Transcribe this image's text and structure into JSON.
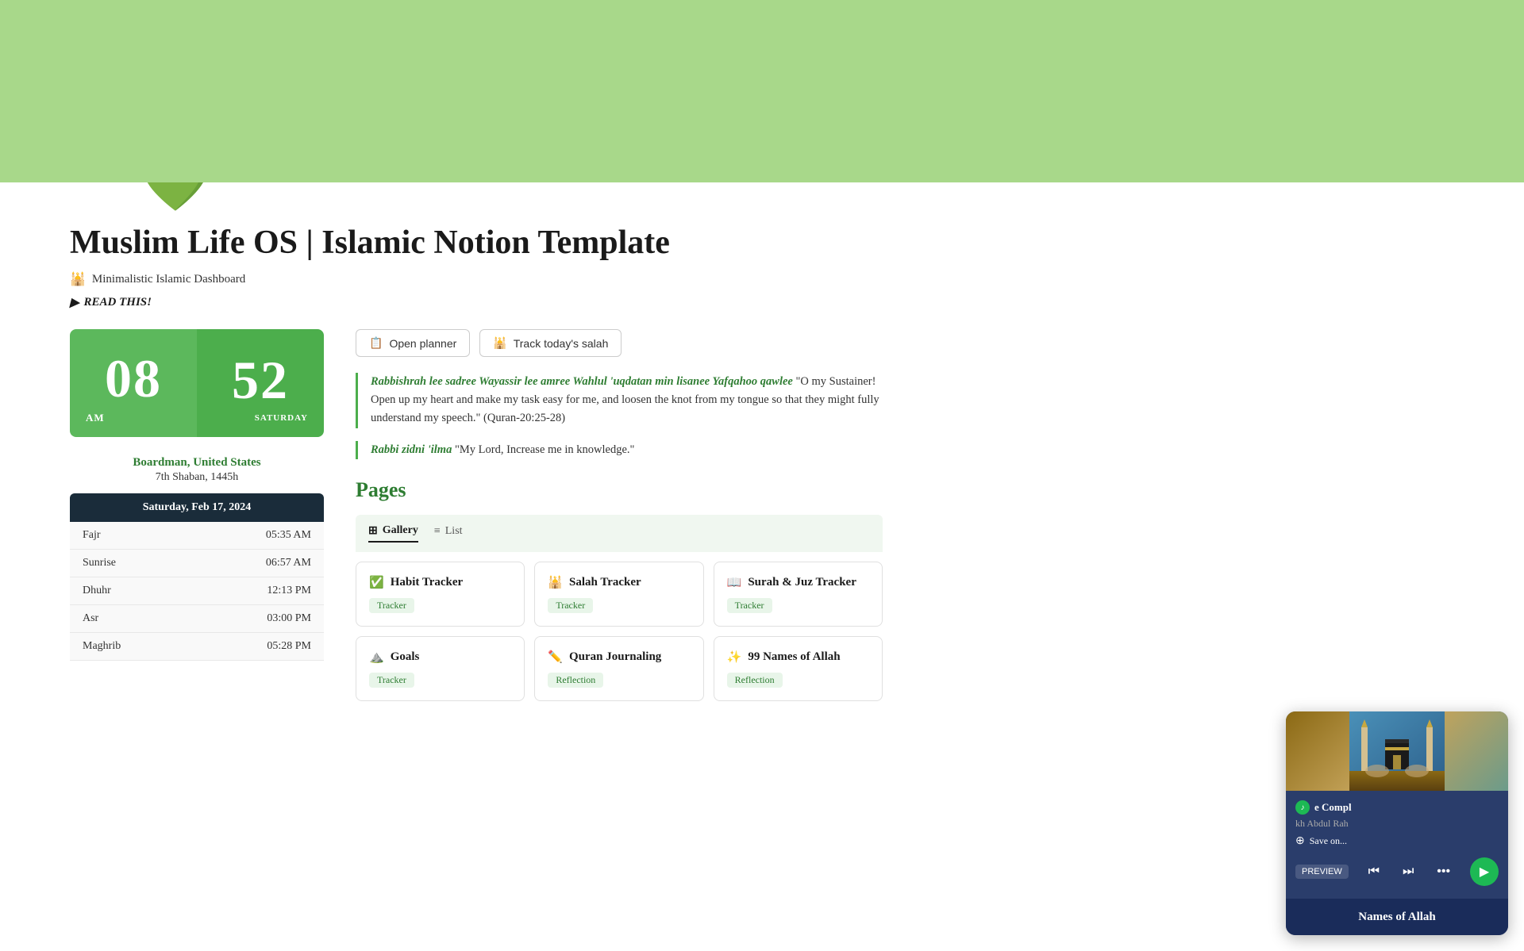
{
  "header": {
    "banner_color": "#a8d88a",
    "icon": "💚",
    "title": "Muslim Life OS | Islamic Notion Template",
    "subtitle": "Minimalistic Islamic Dashboard",
    "read_this_label": "READ THIS!"
  },
  "clock": {
    "hours": "08",
    "minutes": "52",
    "am_pm": "AM",
    "day": "SATURDAY"
  },
  "location": {
    "city": "Boardman, United States",
    "hijri_date": "7th Shaban, 1445h"
  },
  "prayer_date": "Saturday, Feb 17, 2024",
  "prayer_times": [
    {
      "name": "Fajr",
      "time": "05:35 AM"
    },
    {
      "name": "Sunrise",
      "time": "06:57 AM"
    },
    {
      "name": "Dhuhr",
      "time": "12:13 PM"
    },
    {
      "name": "Asr",
      "time": "03:00 PM"
    },
    {
      "name": "Maghrib",
      "time": "05:28 PM"
    }
  ],
  "buttons": {
    "open_planner": "Open planner",
    "track_salah": "Track today's salah"
  },
  "quote1": {
    "arabic": "Rabbishrah lee sadree Wayassir lee amree Wahlul 'uqdatan min lisanee Yafqahoo qawlee",
    "translation": " \"O my Sustainer! Open up my heart and make my task easy for me, and loosen the knot from my tongue so that they might fully understand my speech.\" (Quran-20:25-28)"
  },
  "quote2": {
    "arabic": "Rabbi zidni 'ilma",
    "translation": " \"My Lord, Increase me in knowledge.\""
  },
  "pages": {
    "title": "Pages",
    "tabs": [
      {
        "label": "Gallery",
        "active": true
      },
      {
        "label": "List",
        "active": false
      }
    ],
    "cards": [
      {
        "icon": "✅",
        "title": "Habit Tracker",
        "tag": "Tracker",
        "tag_type": "tracker"
      },
      {
        "icon": "🕌",
        "title": "Salah Tracker",
        "tag": "Tracker",
        "tag_type": "tracker"
      },
      {
        "icon": "📖",
        "title": "Surah & Juz Tracker",
        "tag": "Tracker",
        "tag_type": "tracker"
      },
      {
        "icon": "⛰️",
        "title": "Goals",
        "tag": "Tracker",
        "tag_type": "tracker"
      },
      {
        "icon": "✏️",
        "title": "Quran Journaling",
        "tag": "Reflection",
        "tag_type": "reflection"
      },
      {
        "icon": "✨",
        "title": "99 Names of Allah",
        "tag": "Reflection",
        "tag_type": "reflection"
      }
    ]
  },
  "spotify": {
    "song": "e Compl",
    "artist": "kh Abdul Rah",
    "save_label": "Save on...",
    "preview_label": "PREVIEW"
  },
  "names_of_allah": "Names of Allah"
}
